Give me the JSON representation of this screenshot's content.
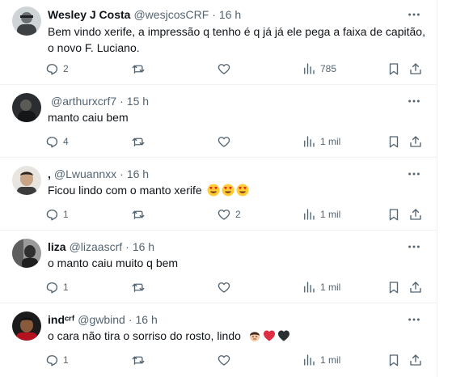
{
  "tweets": [
    {
      "name": "Wesley J Costa",
      "handle": "@wesjcosCRF",
      "time": "16 h",
      "text_line1": "Bem vindo xerife, a impressão q tenho é q já já ele pega a faixa de capitão,",
      "text_line2": "o novo F. Luciano.",
      "replies": "2",
      "retweets": "",
      "likes": "",
      "views": "785"
    },
    {
      "name": "",
      "handle": "@arthurxcrf7",
      "time": "15 h",
      "text": "manto caiu bem",
      "replies": "4",
      "retweets": "",
      "likes": "",
      "views": "1 mil"
    },
    {
      "name": ",",
      "handle": "@Lwuannxx",
      "time": "16 h",
      "text": "Ficou lindo com o manto xerife",
      "replies": "1",
      "retweets": "",
      "likes": "2",
      "views": "1 mil"
    },
    {
      "name": "liza",
      "handle": "@lizaascrf",
      "time": "16 h",
      "text": "o manto caiu muito q bem",
      "replies": "1",
      "retweets": "",
      "likes": "",
      "views": "1 mil"
    },
    {
      "name": "indᶜʳᶠ",
      "handle": "@gwbind",
      "time": "16 h",
      "text": "o cara não tira o sorriso do rosto, lindo",
      "replies": "1",
      "retweets": "",
      "likes": "",
      "views": "1 mil"
    }
  ],
  "separator": "·",
  "icons": {
    "more": "more-dots-icon",
    "reply": "reply-bubble-icon",
    "retweet": "retweet-icon",
    "like": "heart-icon",
    "views": "views-bars-icon",
    "bookmark": "bookmark-icon",
    "share": "share-icon"
  },
  "colors": {
    "text": "#0f1419",
    "secondary": "#536471",
    "divider": "#eff3f4"
  }
}
